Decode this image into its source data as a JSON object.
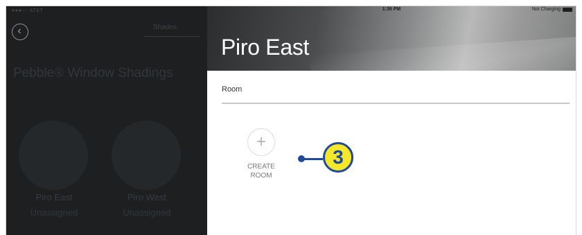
{
  "left_panel": {
    "status_bar": "●●●○○ AT&T ",
    "back_icon": "chevron-left-icon",
    "link_label": "Shades",
    "title": "Pebble® Window Shadings",
    "devices": [
      {
        "inner": [
          "",
          "",
          ""
        ],
        "name": "Piro East",
        "status": "Unassigned"
      },
      {
        "inner": [
          "",
          "",
          ""
        ],
        "name": "Piro West",
        "status": "Unassigned"
      }
    ]
  },
  "status_bar": {
    "time": "1:36 PM",
    "charging": "Not Charging"
  },
  "header": {
    "title": "Piro East"
  },
  "section": {
    "label": "Room"
  },
  "create_room": {
    "icon": "plus-icon",
    "label_line1": "CREATE",
    "label_line2": "ROOM"
  },
  "callout": {
    "number": "3",
    "color_fill": "#f5e72a",
    "color_stroke": "#1f4a9a"
  }
}
